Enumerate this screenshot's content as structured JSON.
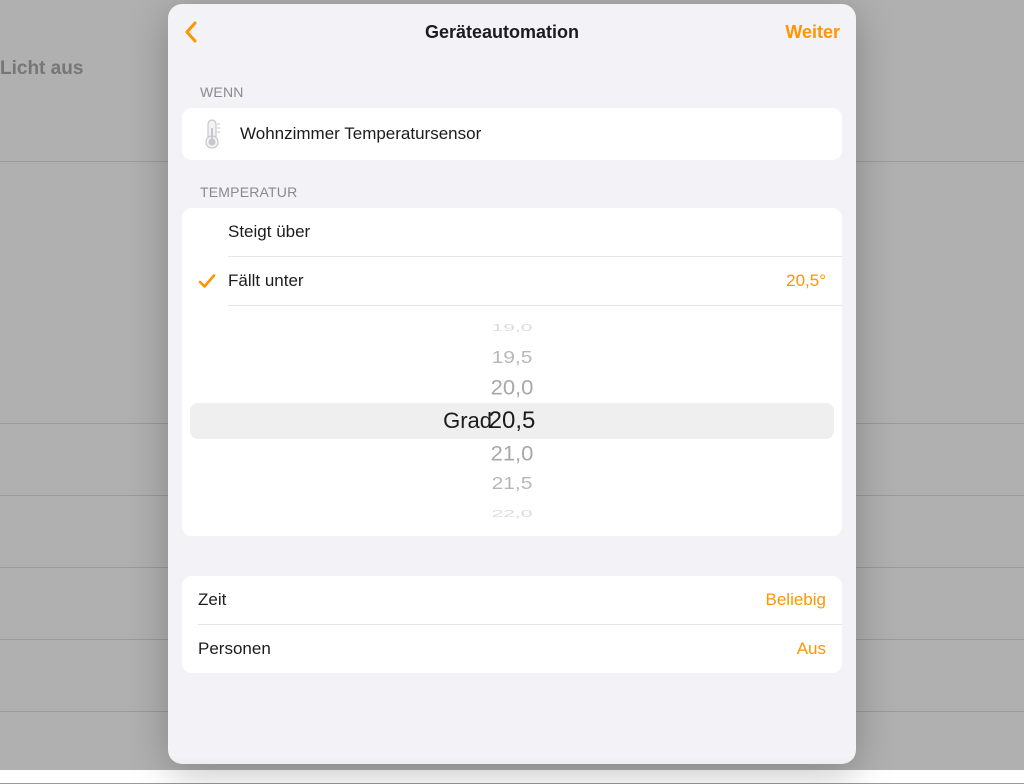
{
  "accent_color": "#ff9500",
  "background": {
    "sidebar_label": "Licht aus"
  },
  "nav": {
    "title": "Geräteautomation",
    "next": "Weiter"
  },
  "wenn": {
    "header": "Wenn",
    "sensor_name": "Wohnzimmer Temperatursensor"
  },
  "temperature": {
    "header": "Temperatur",
    "rises_above_label": "Steigt über",
    "falls_below_label": "Fällt unter",
    "falls_below_value": "20,5°",
    "selected": "falls_below",
    "picker": {
      "unit_label": "Grad",
      "values": [
        "19,0",
        "19,5",
        "20,0",
        "20,5",
        "21,0",
        "21,5",
        "22,0"
      ],
      "selected_index": 3
    }
  },
  "settings": {
    "time_label": "Zeit",
    "time_value": "Beliebig",
    "people_label": "Personen",
    "people_value": "Aus"
  }
}
